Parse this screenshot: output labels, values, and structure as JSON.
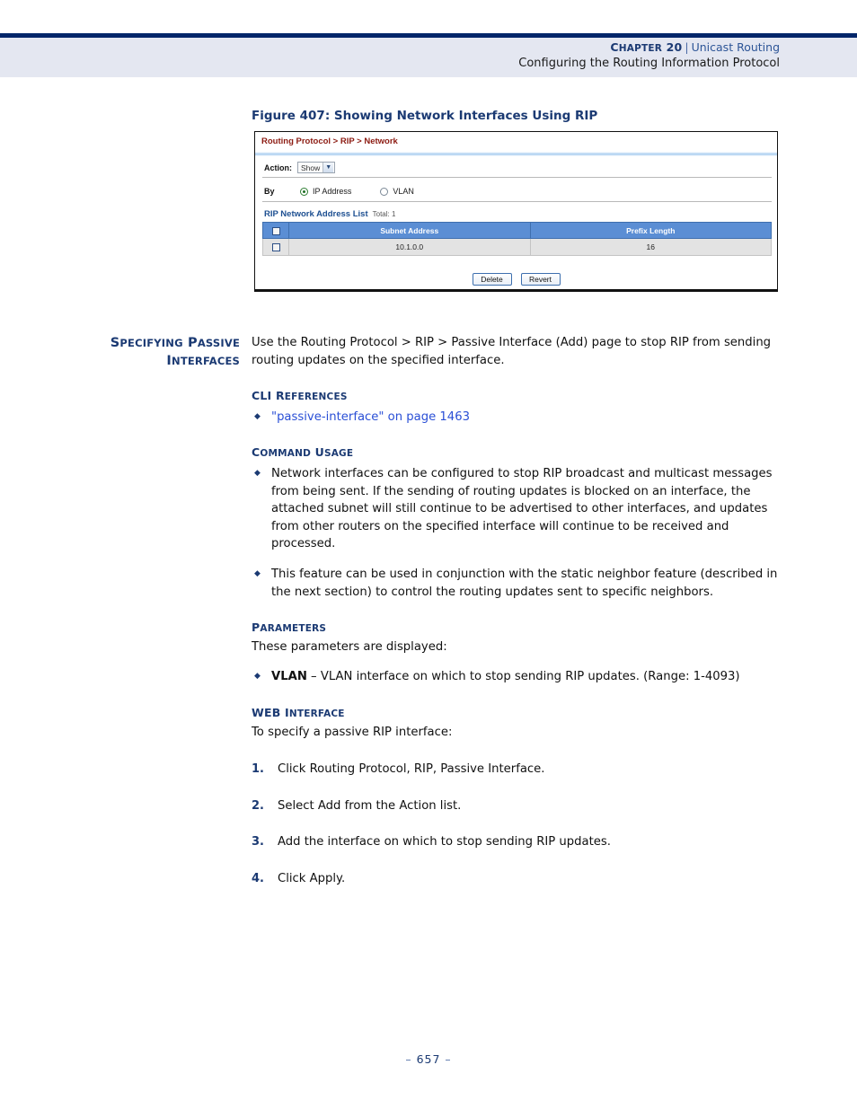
{
  "header": {
    "chapter_label": "CHAPTER 20",
    "separator": "|",
    "chapter_name": "Unicast Routing",
    "subtitle": "Configuring the Routing Information Protocol"
  },
  "figure": {
    "caption": "Figure 407:  Showing Network Interfaces Using RIP",
    "breadcrumb": "Routing Protocol > RIP > Network",
    "action_label": "Action:",
    "action_value": "Show",
    "by_label": "By",
    "radio_ip_label": "IP Address",
    "radio_vlan_label": "VLAN",
    "list_title": "RIP Network Address List",
    "list_total": "Total: 1",
    "columns": [
      "Subnet Address",
      "Prefix Length"
    ],
    "rows": [
      {
        "subnet_address": "10.1.0.0",
        "prefix_length": "16"
      }
    ],
    "delete_button": "Delete",
    "revert_button": "Revert"
  },
  "margin_heading": {
    "line1": "SPECIFYING PASSIVE",
    "line2": "INTERFACES"
  },
  "body": {
    "intro": "Use the Routing Protocol > RIP > Passive Interface (Add) page to stop RIP from sending routing updates on the specified interface.",
    "cli_references_heading": "CLI REFERENCES",
    "cli_reference_link": "\"passive-interface\" on page 1463",
    "command_usage_heading": "COMMAND USAGE",
    "command_usage_bullets": [
      "Network interfaces can be configured to stop RIP broadcast and multicast messages from being sent. If the sending of routing updates is blocked on an interface, the attached subnet will still continue to be advertised to other interfaces, and updates from other routers on the specified interface will continue to be received and processed.",
      "This feature can be used in conjunction with the static neighbor feature (described in the next section) to control the routing updates sent to specific neighbors."
    ],
    "parameters_heading": "PARAMETERS",
    "parameters_intro": "These parameters are displayed:",
    "parameter_name": "VLAN",
    "parameter_desc": " – VLAN interface on which to stop sending RIP updates. (Range: 1-4093)",
    "web_interface_heading": "WEB INTERFACE",
    "web_interface_intro": "To specify a passive RIP interface:",
    "steps": [
      {
        "num": "1.",
        "text": "Click Routing Protocol, RIP, Passive Interface."
      },
      {
        "num": "2.",
        "text": "Select Add from the Action list."
      },
      {
        "num": "3.",
        "text": "Add the interface on which to stop sending RIP updates."
      },
      {
        "num": "4.",
        "text": "Click Apply."
      }
    ]
  },
  "footer": {
    "page_number": "657",
    "dash": "–"
  },
  "colors": {
    "navy": "#002569",
    "header_band": "#e4e7f1",
    "heading_blue": "#1b3a73",
    "link_blue": "#2a4fd6",
    "breadcrumb_red": "#8c1b12",
    "table_header_blue": "#5b8ed4",
    "table_row_gray": "#e3e3e3"
  }
}
